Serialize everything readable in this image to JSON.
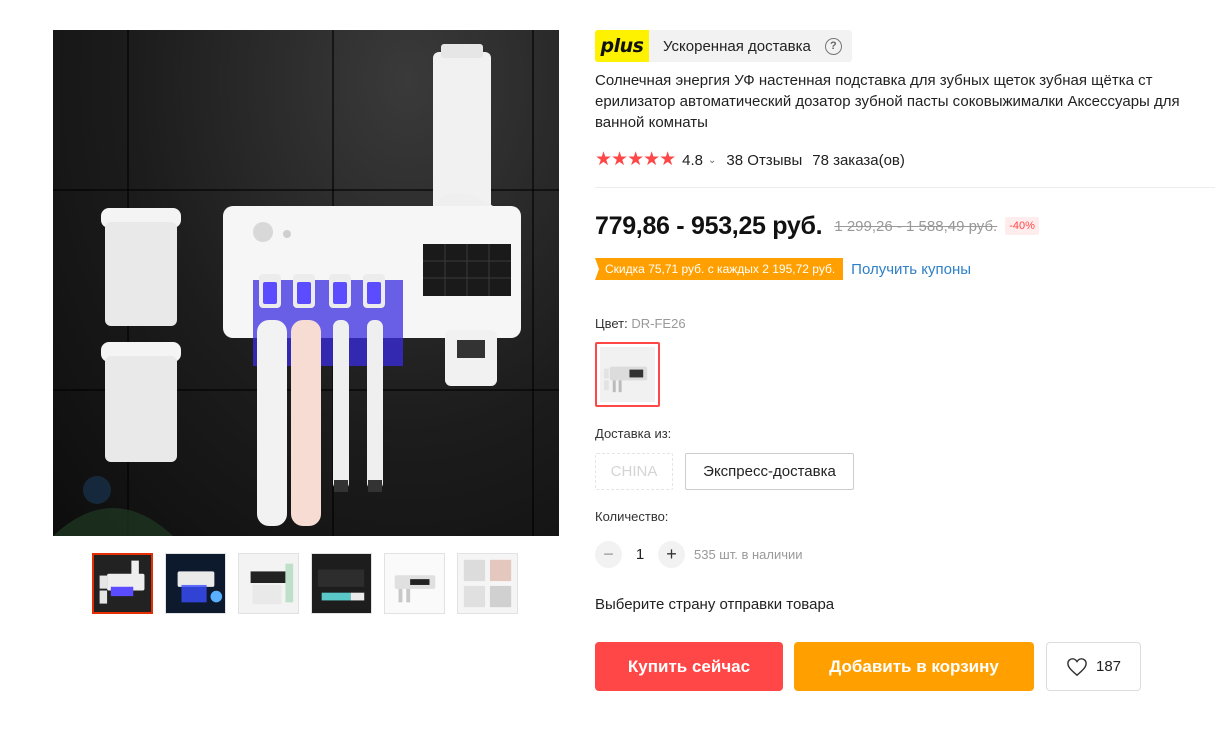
{
  "gallery": {
    "thumbnails": [
      "thumb-1",
      "thumb-2",
      "thumb-3",
      "thumb-4",
      "thumb-5",
      "thumb-6"
    ],
    "active_index": 0
  },
  "plus": {
    "logo": "plus",
    "text": "Ускоренная доставка",
    "help_icon": "?"
  },
  "product": {
    "title": "Солнечная энергия УФ настенная подставка для зубных щеток зубная щётка ст ерилизатор автоматический дозатор зубной пасты соковыжималки Аксессуары для ванной комнаты",
    "stars": "★★★★★",
    "rating": "4.8",
    "rating_chevron": "⌄",
    "reviews": "38 Отзывы",
    "orders": "78 заказа(ов)"
  },
  "price": {
    "current": "779,86 - 953,25 руб.",
    "old": "1 299,26 - 1 588,49 руб.",
    "discount": "-40%"
  },
  "coupon": {
    "tag": "Скидка 75,71 руб. с каждых 2 195,72 руб.",
    "link": "Получить купоны"
  },
  "color": {
    "label": "Цвет:",
    "value": "DR-FE26"
  },
  "shipping": {
    "label": "Доставка из:",
    "options": [
      "CHINA",
      "Экспресс-доставка"
    ]
  },
  "quantity": {
    "label": "Количество:",
    "minus": "−",
    "plus": "+",
    "value": "1",
    "stock": "535 шт. в наличии"
  },
  "select_country": "Выберите страну отправки товара",
  "actions": {
    "buy": "Купить сейчас",
    "cart": "Добавить в корзину",
    "wishlist_count": "187"
  },
  "colors": {
    "primary_red": "#ff4747",
    "orange": "#ffa000",
    "plus_yellow": "#fff200",
    "link_blue": "#2e7fc7"
  }
}
